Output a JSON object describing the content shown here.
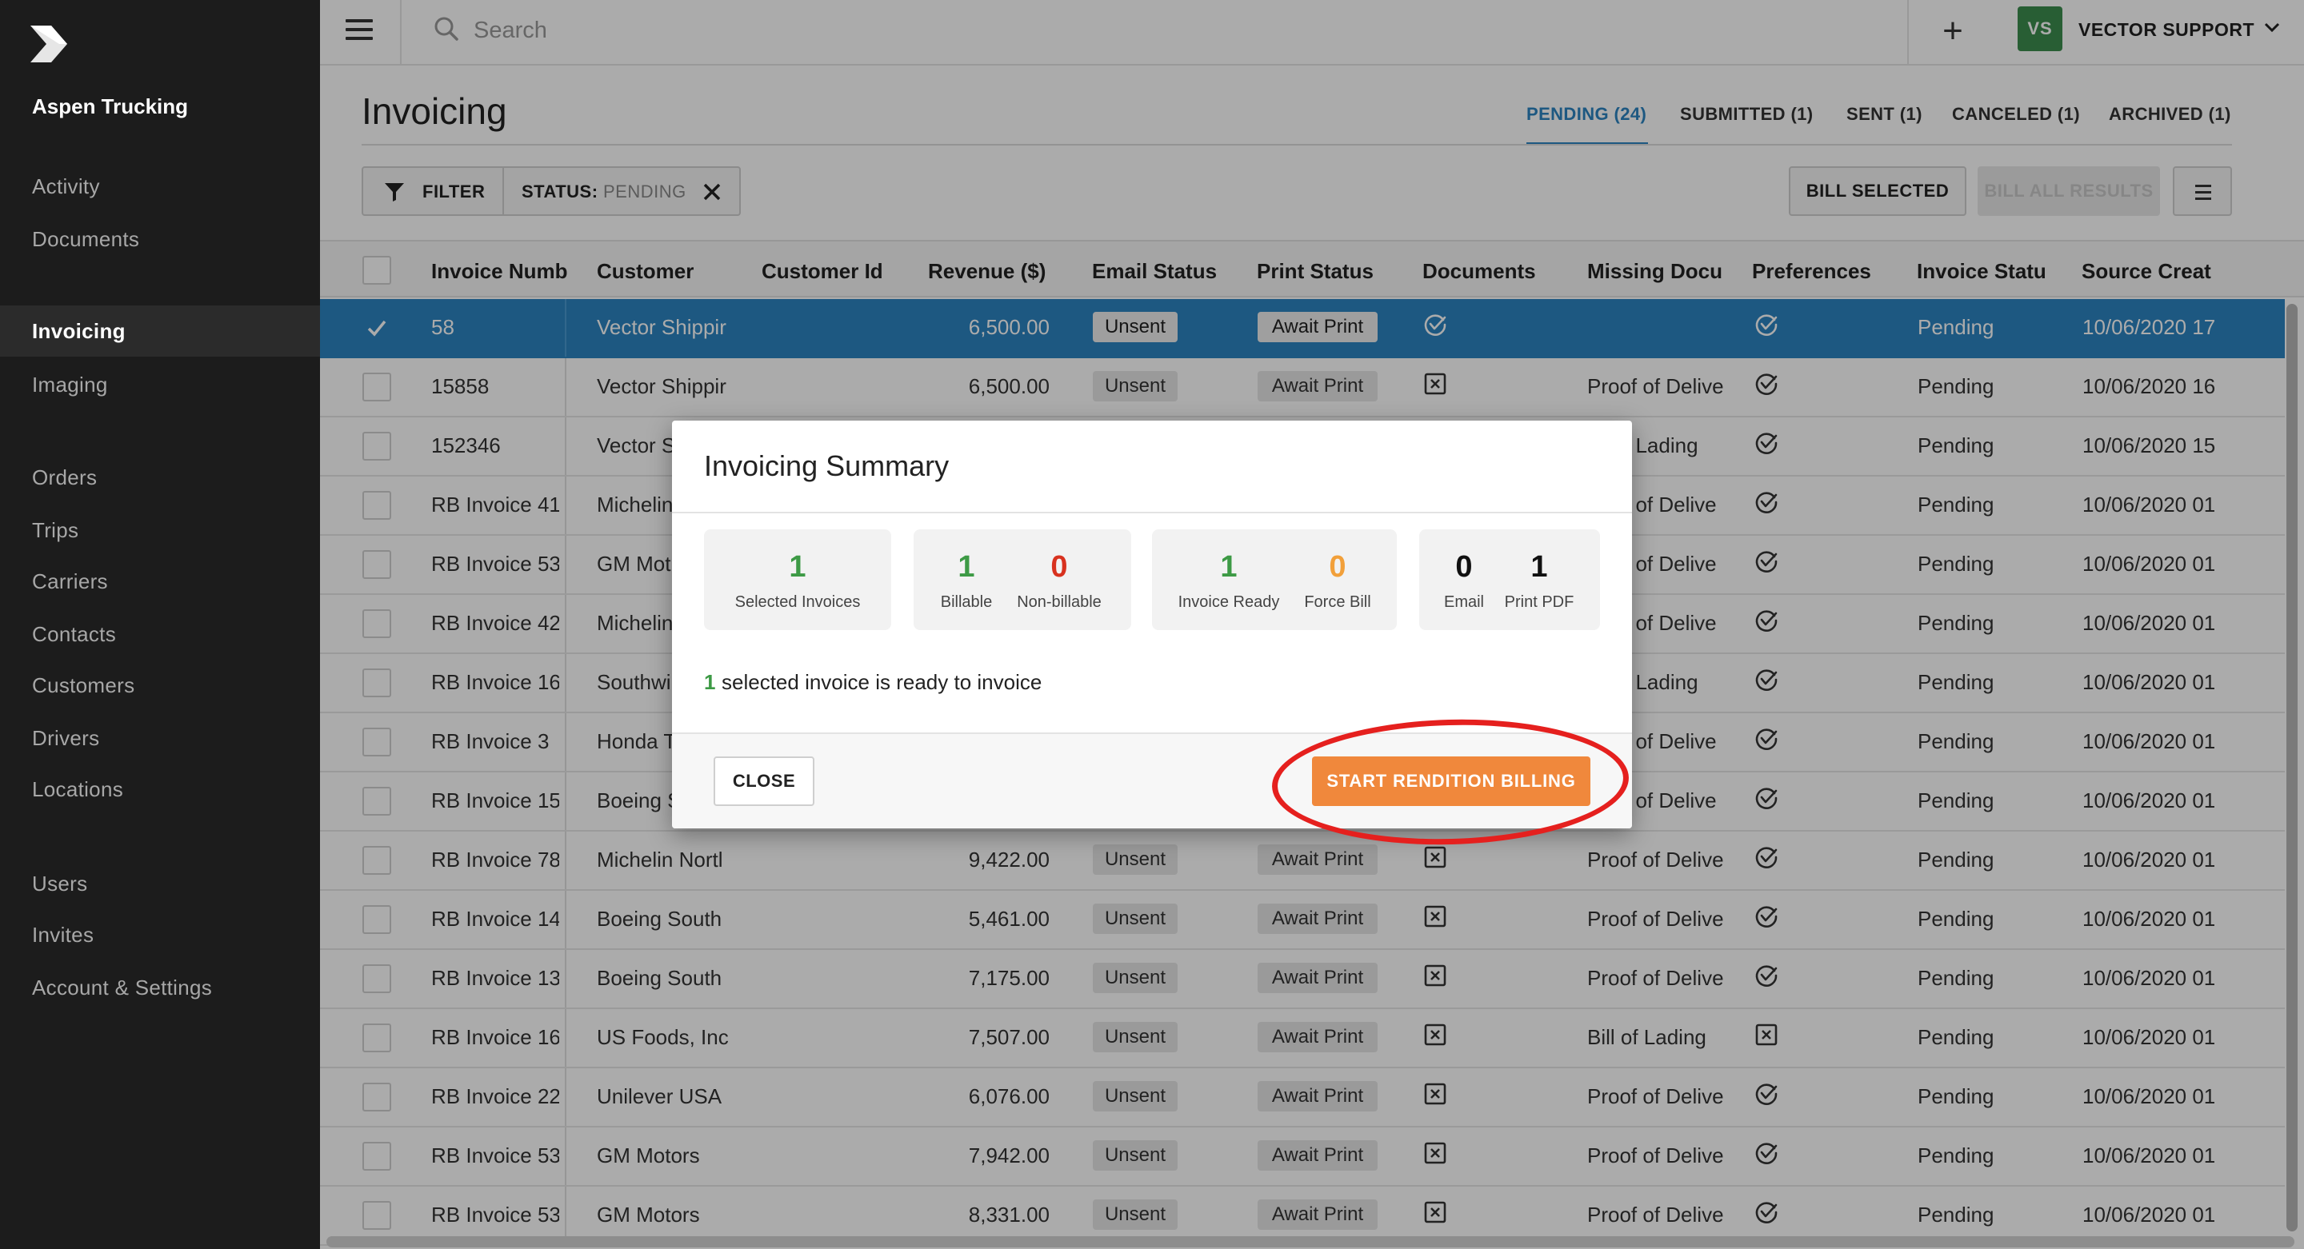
{
  "sidebar": {
    "company": "Aspen Trucking",
    "items": [
      {
        "label": "Activity"
      },
      {
        "label": "Documents"
      },
      {
        "label": "Invoicing",
        "active": true
      },
      {
        "label": "Imaging"
      },
      {
        "label": "Orders"
      },
      {
        "label": "Trips"
      },
      {
        "label": "Carriers"
      },
      {
        "label": "Contacts"
      },
      {
        "label": "Customers"
      },
      {
        "label": "Drivers"
      },
      {
        "label": "Locations"
      },
      {
        "label": "Users"
      },
      {
        "label": "Invites"
      },
      {
        "label": "Account & Settings"
      }
    ]
  },
  "topbar": {
    "search_placeholder": "Search",
    "add_label": "+",
    "user_initials": "VS",
    "user_name": "VECTOR SUPPORT"
  },
  "page": {
    "title": "Invoicing",
    "tabs": [
      {
        "label": "PENDING (24)",
        "active": true
      },
      {
        "label": "SUBMITTED (1)"
      },
      {
        "label": "SENT (1)"
      },
      {
        "label": "CANCELED (1)"
      },
      {
        "label": "ARCHIVED (1)"
      }
    ]
  },
  "toolbar": {
    "filter_label": "FILTER",
    "status_label": "STATUS:",
    "status_value": "PENDING",
    "bill_selected_label": "BILL SELECTED",
    "bill_all_label": "BILL ALL RESULTS"
  },
  "table": {
    "columns": [
      "Invoice Numb",
      "Customer",
      "Customer Id",
      "Revenue ($)",
      "Email Status",
      "Print Status",
      "Documents",
      "Missing Docu",
      "Preferences",
      "Invoice Statu",
      "Source Creat"
    ],
    "rows": [
      {
        "number": "58",
        "customer": "Vector Shippir",
        "revenue": "6,500.00",
        "email": "Unsent",
        "print": "Await Print",
        "docs": "check",
        "missing": "",
        "pref": "check",
        "status": "Pending",
        "created": "10/06/2020 17",
        "selected": true
      },
      {
        "number": "15858",
        "customer": "Vector Shippir",
        "revenue": "6,500.00",
        "email": "Unsent",
        "print": "Await Print",
        "docs": "x",
        "missing": "Proof of Delive",
        "pref": "check",
        "status": "Pending",
        "created": "10/06/2020 16"
      },
      {
        "number": "152346",
        "customer": "Vector S",
        "revenue": "",
        "email": "",
        "print": "",
        "docs": "",
        "missing": "f Lading",
        "pref": "check",
        "status": "Pending",
        "created": "10/06/2020 15"
      },
      {
        "number": "RB Invoice 41",
        "customer": "Michelin",
        "revenue": "",
        "email": "",
        "print": "",
        "docs": "",
        "missing": "f of Delive",
        "pref": "check",
        "status": "Pending",
        "created": "10/06/2020 01"
      },
      {
        "number": "RB Invoice 53",
        "customer": "GM Mot",
        "revenue": "",
        "email": "",
        "print": "",
        "docs": "",
        "missing": "f of Delive",
        "pref": "check",
        "status": "Pending",
        "created": "10/06/2020 01"
      },
      {
        "number": "RB Invoice 42",
        "customer": "Michelin",
        "revenue": "",
        "email": "",
        "print": "",
        "docs": "",
        "missing": "f of Delive",
        "pref": "check",
        "status": "Pending",
        "created": "10/06/2020 01"
      },
      {
        "number": "RB Invoice 16",
        "customer": "Southwi",
        "revenue": "",
        "email": "",
        "print": "",
        "docs": "",
        "missing": "f Lading",
        "pref": "check",
        "status": "Pending",
        "created": "10/06/2020 01"
      },
      {
        "number": "RB Invoice 3",
        "customer": "Honda T",
        "revenue": "",
        "email": "",
        "print": "",
        "docs": "",
        "missing": "f of Delive",
        "pref": "check",
        "status": "Pending",
        "created": "10/06/2020 01"
      },
      {
        "number": "RB Invoice 15",
        "customer": "Boeing S",
        "revenue": "",
        "email": "",
        "print": "",
        "docs": "",
        "missing": "f of Delive",
        "pref": "check",
        "status": "Pending",
        "created": "10/06/2020 01"
      },
      {
        "number": "RB Invoice 78",
        "customer": "Michelin Nortl",
        "revenue": "9,422.00",
        "email": "Unsent",
        "print": "Await Print",
        "docs": "x",
        "missing": "Proof of Delive",
        "pref": "check",
        "status": "Pending",
        "created": "10/06/2020 01"
      },
      {
        "number": "RB Invoice 14",
        "customer": "Boeing South",
        "revenue": "5,461.00",
        "email": "Unsent",
        "print": "Await Print",
        "docs": "x",
        "missing": "Proof of Delive",
        "pref": "check",
        "status": "Pending",
        "created": "10/06/2020 01"
      },
      {
        "number": "RB Invoice 13",
        "customer": "Boeing South",
        "revenue": "7,175.00",
        "email": "Unsent",
        "print": "Await Print",
        "docs": "x",
        "missing": "Proof of Delive",
        "pref": "check",
        "status": "Pending",
        "created": "10/06/2020 01"
      },
      {
        "number": "RB Invoice 16",
        "customer": "US Foods, Inc",
        "revenue": "7,507.00",
        "email": "Unsent",
        "print": "Await Print",
        "docs": "x",
        "missing": "Bill of Lading",
        "pref": "x",
        "status": "Pending",
        "created": "10/06/2020 01"
      },
      {
        "number": "RB Invoice 22",
        "customer": "Unilever USA",
        "revenue": "6,076.00",
        "email": "Unsent",
        "print": "Await Print",
        "docs": "x",
        "missing": "Proof of Delive",
        "pref": "check",
        "status": "Pending",
        "created": "10/06/2020 01"
      },
      {
        "number": "RB Invoice 53",
        "customer": "GM Motors",
        "revenue": "7,942.00",
        "email": "Unsent",
        "print": "Await Print",
        "docs": "x",
        "missing": "Proof of Delive",
        "pref": "check",
        "status": "Pending",
        "created": "10/06/2020 01"
      },
      {
        "number": "RB Invoice 53",
        "customer": "GM Motors",
        "revenue": "8,331.00",
        "email": "Unsent",
        "print": "Await Print",
        "docs": "x",
        "missing": "Proof of Delive",
        "pref": "check",
        "status": "Pending",
        "created": "10/06/2020 01"
      }
    ]
  },
  "modal": {
    "title": "Invoicing Summary",
    "cards": [
      {
        "items": [
          {
            "value": "1",
            "label": "Selected Invoices",
            "color": "green"
          }
        ]
      },
      {
        "items": [
          {
            "value": "1",
            "label": "Billable",
            "color": "green"
          },
          {
            "value": "0",
            "label": "Non-billable",
            "color": "red"
          }
        ]
      },
      {
        "items": [
          {
            "value": "1",
            "label": "Invoice Ready",
            "color": "green"
          },
          {
            "value": "0",
            "label": "Force Bill",
            "color": "orange"
          }
        ]
      },
      {
        "items": [
          {
            "value": "0",
            "label": "Email",
            "color": "black"
          },
          {
            "value": "1",
            "label": "Print PDF",
            "color": "black"
          }
        ]
      }
    ],
    "ready_count": "1",
    "ready_text": "selected invoice is ready to invoice",
    "close_label": "CLOSE",
    "start_label": "START RENDITION BILLING"
  },
  "colors": {
    "accent_blue": "#2c84c1",
    "action_orange": "#f0883c",
    "highlight_red": "#e5201e",
    "success_green": "#3d9a45"
  },
  "icons": {
    "logo": "vector-logo-icon",
    "menu": "hamburger-icon",
    "search": "search-icon",
    "add": "plus-icon",
    "user_menu": "chevron-down-icon",
    "filter": "funnel-icon",
    "clear_filter": "close-icon",
    "columns_menu": "list-icon",
    "settings": "gear-icon",
    "ok": "check-circle-icon",
    "missing": "x-box-icon"
  }
}
